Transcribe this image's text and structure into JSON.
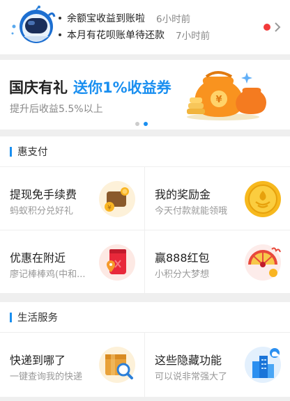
{
  "notice": {
    "items": [
      {
        "text": "余额宝收益到账啦",
        "time": "6小时前"
      },
      {
        "text": "本月有花呗账单待还款",
        "time": "7小时前"
      }
    ],
    "colors": {
      "unread_dot": "#f23a3a"
    }
  },
  "banner": {
    "title_main": "国庆有礼",
    "title_highlight": "送你1%收益券",
    "subtitle": "提升后收益5.5%以上",
    "dots_active_index": 1,
    "colors": {
      "highlight": "#1a8ff0"
    }
  },
  "sections": [
    {
      "header": "惠支付",
      "cards": [
        {
          "title": "提现免手续费",
          "subtitle": "蚂蚁积分兑好礼",
          "icon": "wallet-icon"
        },
        {
          "title": "我的奖励金",
          "subtitle": "今天付款就能领哦",
          "icon": "gold-coin-icon"
        },
        {
          "title": "优惠在附近",
          "subtitle": "廖记棒棒鸡(中和...",
          "icon": "coupon-location-icon"
        },
        {
          "title": "赢888红包",
          "subtitle": "小积分大梦想",
          "icon": "prize-wheel-icon"
        }
      ]
    },
    {
      "header": "生活服务",
      "cards": [
        {
          "title": "快递到哪了",
          "subtitle": "一键查询我的快递",
          "icon": "package-search-icon"
        },
        {
          "title": "这些隐藏功能",
          "subtitle": "可以说非常强大了",
          "icon": "city-cloud-icon"
        }
      ]
    }
  ]
}
